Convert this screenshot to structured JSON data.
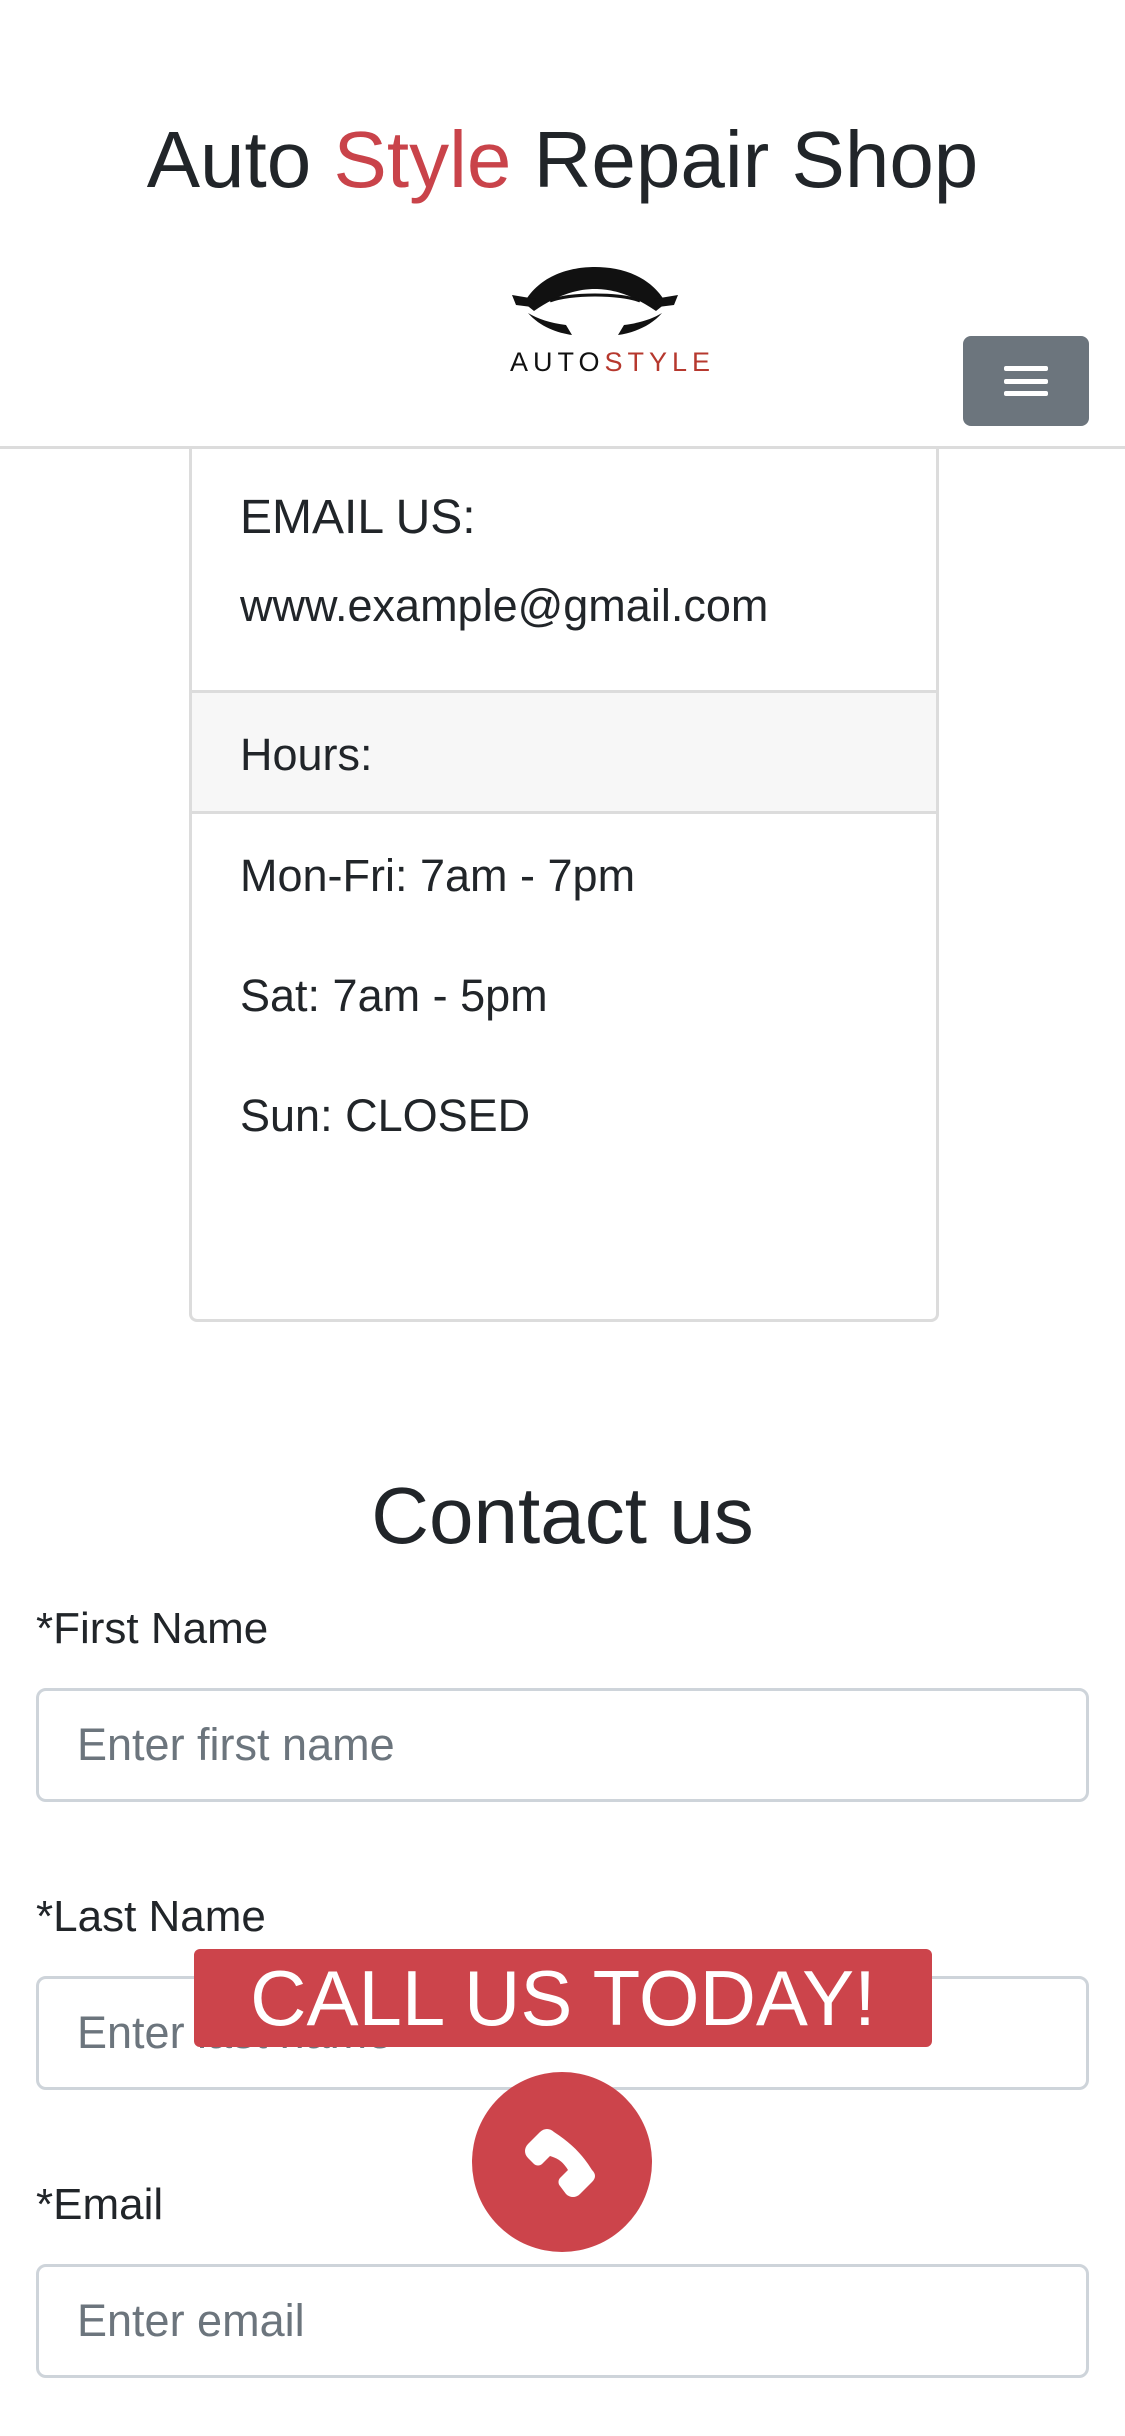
{
  "header": {
    "title_part1": "Auto ",
    "title_accent": "Style",
    "title_part2": " Repair Shop",
    "logo_text_auto": "AUTO",
    "logo_text_style": "STYLE",
    "menu_icon": "hamburger-menu-icon"
  },
  "info_card": {
    "email_heading": "EMAIL US:",
    "email_value": "www.example@gmail.com",
    "hours_heading": "Hours:",
    "hours": [
      "Mon-Fri: 7am - 7pm",
      "Sat: 7am - 5pm",
      "Sun: CLOSED"
    ]
  },
  "contact": {
    "title": "Contact us",
    "first_name_label": "*First Name",
    "first_name_placeholder": "Enter first name",
    "last_name_label": "*Last Name",
    "last_name_placeholder": "Enter last name",
    "email_label": "*Email",
    "email_placeholder": "Enter email"
  },
  "call_to_action": {
    "banner_text": "CALL US TODAY!",
    "button_icon": "phone-icon"
  },
  "colors": {
    "accent": "#cc444b",
    "menu_button": "#6c757d"
  }
}
